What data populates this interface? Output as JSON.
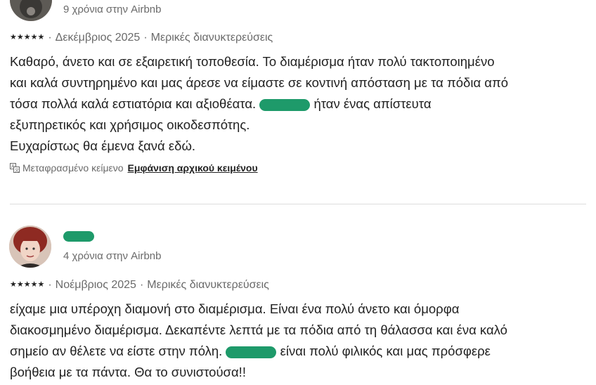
{
  "review1": {
    "tenure": "9 χρόνια στην Airbnb",
    "stars": "★★★★★",
    "date": "Δεκέμβριος 2025",
    "stay": "Μερικές διανυκτερεύσεις",
    "lines": [
      "Καθαρό, άνετο και σε εξαιρετική τοποθεσία. Το διαμέρισμα ήταν πολύ τακτοποιημένο",
      "και καλά συντηρημένο και μας άρεσε να είμαστε σε κοντινή απόσταση με τα πόδια από",
      "τόσα πολλά καλά εστιατόρια και αξιοθέατα."
    ],
    "line3_after": "ήταν ένας απίστευτα",
    "line4": "εξυπηρετικός και χρήσιμος οικοδεσπότης.",
    "line5": "Ευχαρίστως θα έμενα ξανά εδώ.",
    "translated_label": "Μεταφρασμένο κείμενο",
    "show_original": "Εμφάνιση αρχικού κειμένου"
  },
  "review2": {
    "tenure": "4 χρόνια στην Airbnb",
    "stars": "★★★★★",
    "date": "Νοέμβριος 2025",
    "stay": "Μερικές διανυκτερεύσεις",
    "lines": [
      "είχαμε μια υπέροχη διαμονή στο διαμέρισμα. Είναι ένα πολύ άνετο και όμορφα",
      "διακοσμημένο διαμέρισμα. Δεκαπέντε λεπτά με τα πόδια από τη θάλασσα και ένα καλό",
      "σημείο αν θέλετε να είστε στην πόλη."
    ],
    "line3_after": "είναι πολύ φιλικός και μας πρόσφερε",
    "line4": "βοήθεια με τα πάντα. Θα το συνιστούσα!!"
  },
  "colors": {
    "redaction": "#1e9a6a",
    "text": "#222222",
    "muted": "#6a6a6a",
    "divider": "#dddddd"
  }
}
